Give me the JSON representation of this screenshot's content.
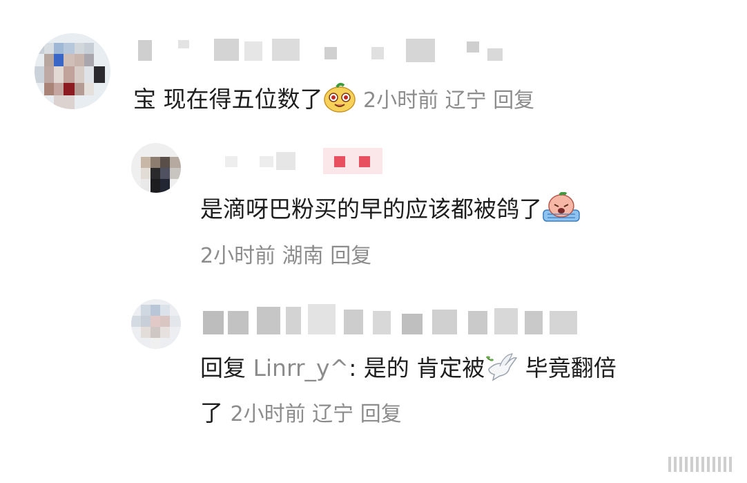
{
  "comments": [
    {
      "text": "宝 现在得五位数了",
      "emoji": "yellow-cartoon-face-emoji",
      "meta": {
        "time": "2小时前",
        "location": "辽宁",
        "reply": "回复"
      }
    },
    {
      "text": "是滴呀巴粉买的早的应该都被鸽了",
      "emoji": "crying-cartoon-face-emoji",
      "meta": {
        "time": "2小时前",
        "location": "湖南",
        "reply": "回复"
      }
    },
    {
      "prefix": "回复",
      "mention": "Linrr_y^",
      "text_part1": ": 是的 肯定被",
      "text_part2": " 毕竟翻倍",
      "text_line2": "了",
      "emoji": "dove-emoji",
      "meta": {
        "time": "2小时前",
        "location": "辽宁",
        "reply": "回复"
      }
    }
  ],
  "colors": {
    "text": "#1e1e1e",
    "meta": "#8c8c8c",
    "background": "#ffffff"
  }
}
